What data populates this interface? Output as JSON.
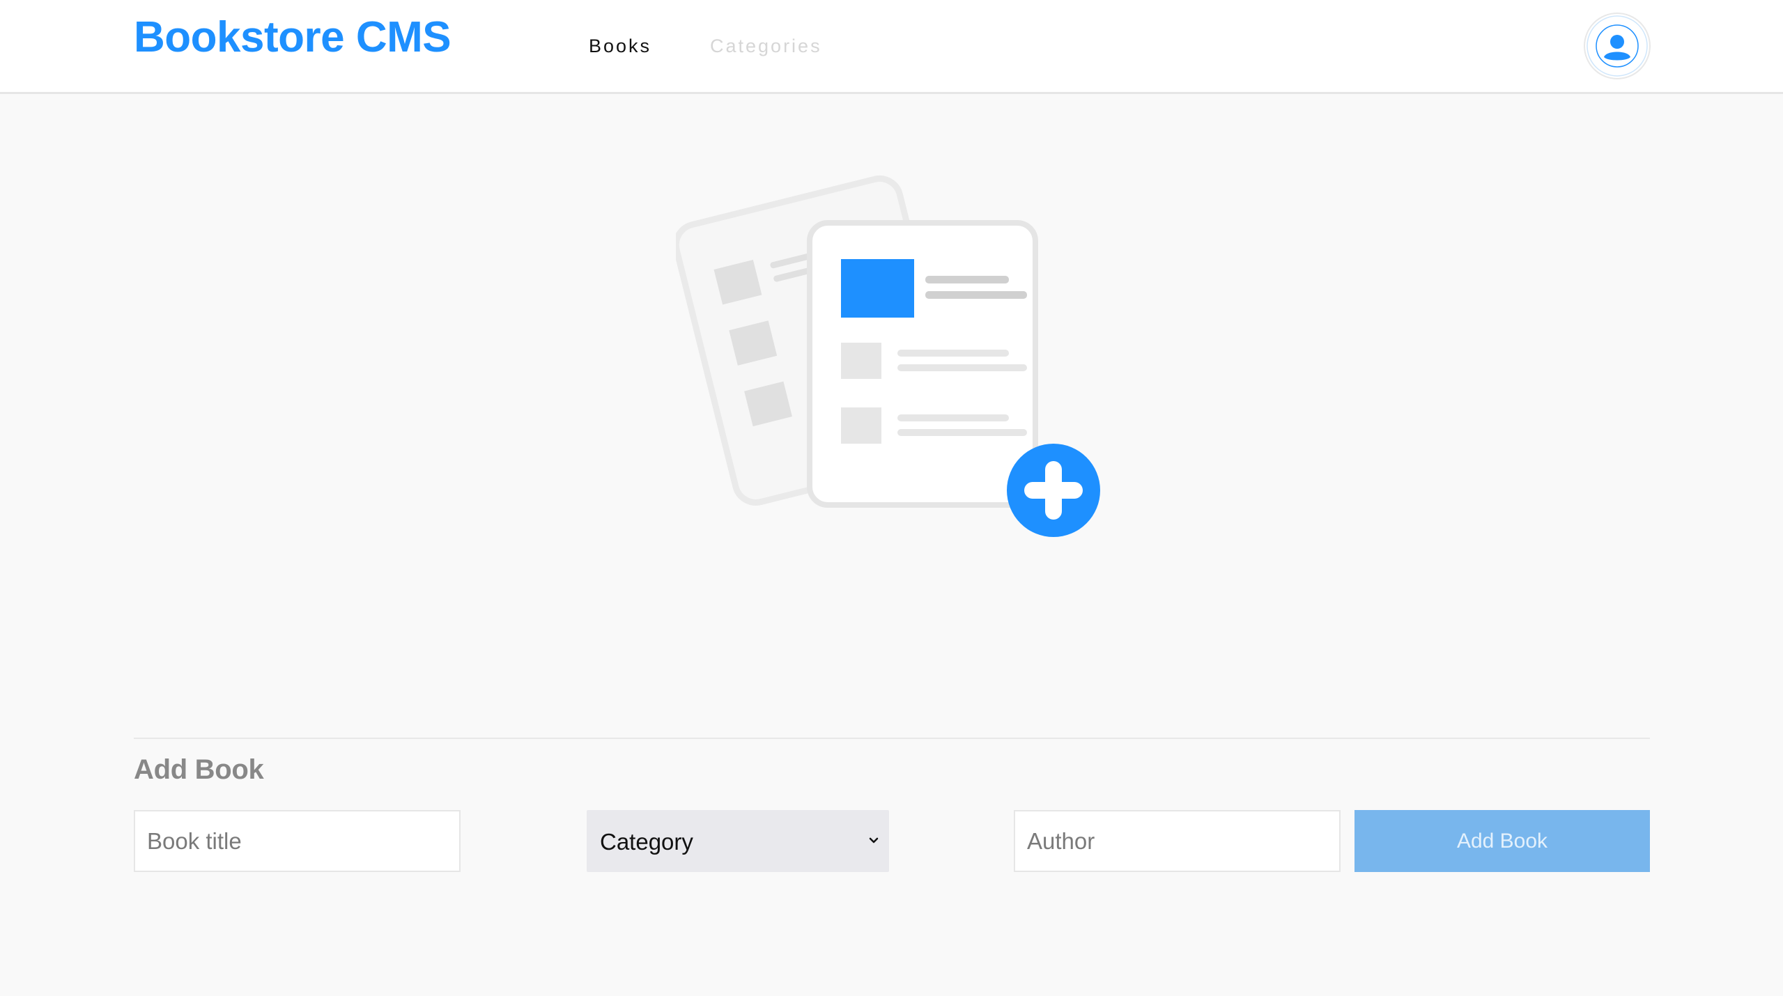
{
  "header": {
    "logo": "Bookstore CMS",
    "nav": [
      {
        "label": "Books",
        "active": true
      },
      {
        "label": "Categories",
        "active": false
      }
    ],
    "avatar_icon": "user-icon"
  },
  "main": {
    "illustration_icon": "add-document-icon"
  },
  "form": {
    "title": "Add Book",
    "title_placeholder": "Book title",
    "category_selected": "Category",
    "author_placeholder": "Author",
    "submit_label": "Add Book"
  },
  "colors": {
    "accent": "#1e90ff",
    "button_bg": "#78b6ed",
    "page_bg": "#f9f9f9"
  }
}
